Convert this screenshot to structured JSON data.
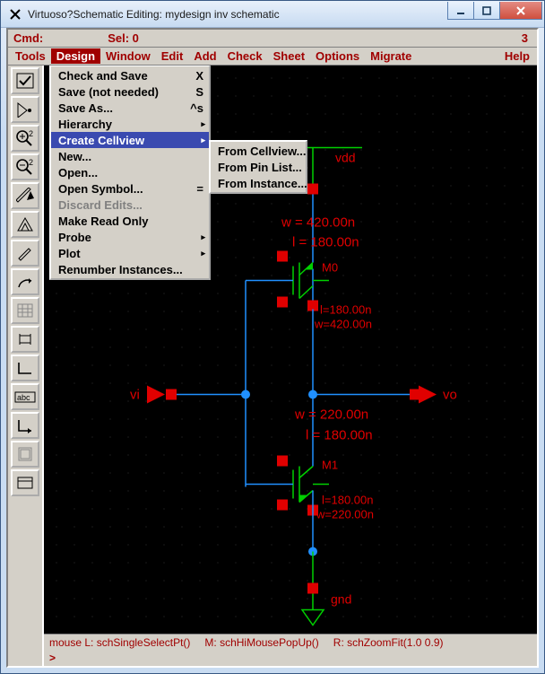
{
  "window": {
    "title": "Virtuoso?Schematic Editing: mydesign inv schematic",
    "buttons": {
      "min": "_",
      "max": "▢",
      "close": "X"
    }
  },
  "cmdbar": {
    "cmd_label": "Cmd:",
    "sel_label": "Sel: 0",
    "right_num": "3"
  },
  "menubar": {
    "items": [
      "Tools",
      "Design",
      "Window",
      "Edit",
      "Add",
      "Check",
      "Sheet",
      "Options",
      "Migrate"
    ],
    "help": "Help",
    "active_index": 1
  },
  "design_menu": {
    "rows": [
      {
        "label": "Check and Save",
        "accel": "X"
      },
      {
        "label": "Save (not needed)",
        "accel": "S"
      },
      {
        "label": "Save As...",
        "accel": "^s"
      },
      {
        "label": "Hierarchy",
        "sub": true
      },
      {
        "label": "Create Cellview",
        "sub": true,
        "highlight": true
      },
      {
        "label": "New..."
      },
      {
        "label": "Open..."
      },
      {
        "label": "Open Symbol...",
        "accel": "="
      },
      {
        "label": "Discard Edits...",
        "disabled": true
      },
      {
        "label": "Make Read Only"
      },
      {
        "label": "Probe",
        "sub": true
      },
      {
        "label": "Plot",
        "sub": true
      },
      {
        "label": "Renumber Instances..."
      }
    ]
  },
  "cellview_submenu": {
    "rows": [
      {
        "label": "From Cellview..."
      },
      {
        "label": "From Pin List..."
      },
      {
        "label": "From Instance..."
      }
    ]
  },
  "toolbar": {
    "buttons": [
      "check-icon",
      "save-icon",
      "zoom-in-icon",
      "zoom-out-icon",
      "ruler-icon",
      "hierarchy-icon",
      "pencil-icon",
      "arc-icon",
      "grid-icon",
      "component-icon",
      "wire-icon",
      "label-box-icon",
      "pin-icon",
      "sheet-icon",
      "cmd-icon"
    ]
  },
  "schematic": {
    "pins": {
      "vdd": "vdd",
      "gnd": "gnd",
      "vi": "vi",
      "vo": "vo"
    },
    "pmos": {
      "name": "M0",
      "params_top": [
        "w = 420.00n",
        "l = 180.00n"
      ],
      "params_side": [
        "l=180.00n",
        "w=420.00n"
      ]
    },
    "nmos": {
      "name": "M1",
      "params_top": [
        "w = 220.00n",
        "l = 180.00n"
      ],
      "params_side": [
        "l=180.00n",
        "w=220.00n"
      ]
    }
  },
  "mousehint": {
    "left": "mouse L: schSingleSelectPt()",
    "mid": "M: schHiMousePopUp()",
    "right": "R: schZoomFit(1.0 0.9)"
  },
  "prompt": ">"
}
